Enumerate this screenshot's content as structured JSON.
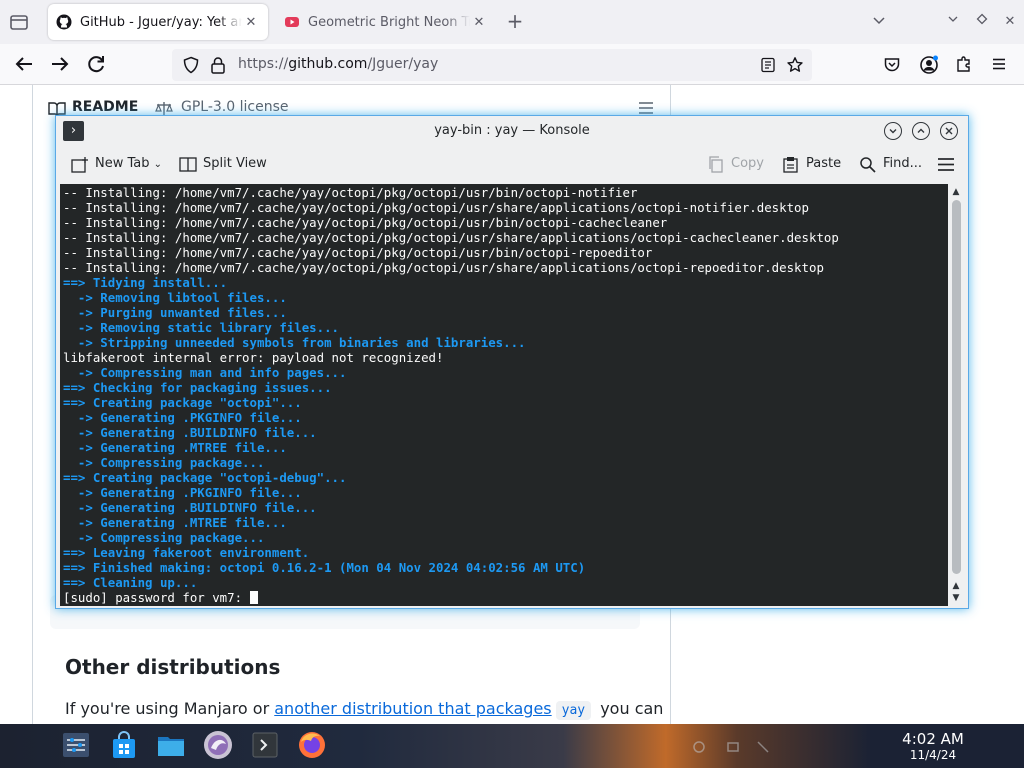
{
  "browser": {
    "tabs": [
      {
        "title": "GitHub - Jguer/yay: Yet another Yogurt",
        "active": true
      },
      {
        "title": "Geometric Bright Neon Triangles",
        "active": false
      }
    ],
    "url_prefix": "https://",
    "url_host": "github.com",
    "url_path": "/Jguer/yay"
  },
  "page": {
    "readme_tab": "README",
    "license_tab": "GPL-3.0 license",
    "heading": "Other distributions",
    "para_before": "If you're using Manjaro or ",
    "para_link": "another distribution that packages",
    "para_code": "yay",
    "para_after": " you can"
  },
  "konsole": {
    "window_title": "yay-bin : yay — Konsole",
    "toolbar": {
      "new_tab": "New Tab",
      "split_view": "Split View",
      "copy": "Copy",
      "paste": "Paste",
      "find": "Find..."
    },
    "lines": [
      {
        "text": "-- Installing: /home/vm7/.cache/yay/octopi/pkg/octopi/usr/bin/octopi-notifier",
        "kind": "plain"
      },
      {
        "text": "-- Installing: /home/vm7/.cache/yay/octopi/pkg/octopi/usr/share/applications/octopi-notifier.desktop",
        "kind": "plain"
      },
      {
        "text": "-- Installing: /home/vm7/.cache/yay/octopi/pkg/octopi/usr/bin/octopi-cachecleaner",
        "kind": "plain"
      },
      {
        "text": "-- Installing: /home/vm7/.cache/yay/octopi/pkg/octopi/usr/share/applications/octopi-cachecleaner.desktop",
        "kind": "plain"
      },
      {
        "text": "-- Installing: /home/vm7/.cache/yay/octopi/pkg/octopi/usr/bin/octopi-repoeditor",
        "kind": "plain"
      },
      {
        "text": "-- Installing: /home/vm7/.cache/yay/octopi/pkg/octopi/usr/share/applications/octopi-repoeditor.desktop",
        "kind": "plain"
      },
      {
        "text": "==> Tidying install...",
        "kind": "arrow"
      },
      {
        "text": "  -> Removing libtool files...",
        "kind": "sub"
      },
      {
        "text": "  -> Purging unwanted files...",
        "kind": "sub"
      },
      {
        "text": "  -> Removing static library files...",
        "kind": "sub"
      },
      {
        "text": "  -> Stripping unneeded symbols from binaries and libraries...",
        "kind": "sub"
      },
      {
        "text": "libfakeroot internal error: payload not recognized!",
        "kind": "plain"
      },
      {
        "text": "  -> Compressing man and info pages...",
        "kind": "sub"
      },
      {
        "text": "==> Checking for packaging issues...",
        "kind": "arrow"
      },
      {
        "text": "==> Creating package \"octopi\"...",
        "kind": "arrow"
      },
      {
        "text": "  -> Generating .PKGINFO file...",
        "kind": "sub"
      },
      {
        "text": "  -> Generating .BUILDINFO file...",
        "kind": "sub"
      },
      {
        "text": "  -> Generating .MTREE file...",
        "kind": "sub"
      },
      {
        "text": "  -> Compressing package...",
        "kind": "sub"
      },
      {
        "text": "==> Creating package \"octopi-debug\"...",
        "kind": "arrow"
      },
      {
        "text": "  -> Generating .PKGINFO file...",
        "kind": "sub"
      },
      {
        "text": "  -> Generating .BUILDINFO file...",
        "kind": "sub"
      },
      {
        "text": "  -> Generating .MTREE file...",
        "kind": "sub"
      },
      {
        "text": "  -> Compressing package...",
        "kind": "sub"
      },
      {
        "text": "==> Leaving fakeroot environment.",
        "kind": "arrow"
      },
      {
        "text": "==> Finished making: octopi 0.16.2-1 (Mon 04 Nov 2024 04:02:56 AM UTC)",
        "kind": "arrow"
      },
      {
        "text": "==> Cleaning up...",
        "kind": "arrow"
      },
      {
        "text": "[sudo] password for vm7: ",
        "kind": "plain",
        "cursor": true
      }
    ]
  },
  "taskbar": {
    "time": "4:02 AM",
    "date": "11/4/24",
    "icons": [
      "application-launcher-icon",
      "discover-store-icon",
      "dolphin-file-manager-icon",
      "octopi-icon",
      "konsole-icon",
      "firefox-icon"
    ]
  },
  "colors": {
    "terminal_bg": "#232627",
    "terminal_fg": "#fcfcfc",
    "terminal_accent": "#1d99f3",
    "focus_glow": "#3daee9",
    "link": "#0969da"
  }
}
